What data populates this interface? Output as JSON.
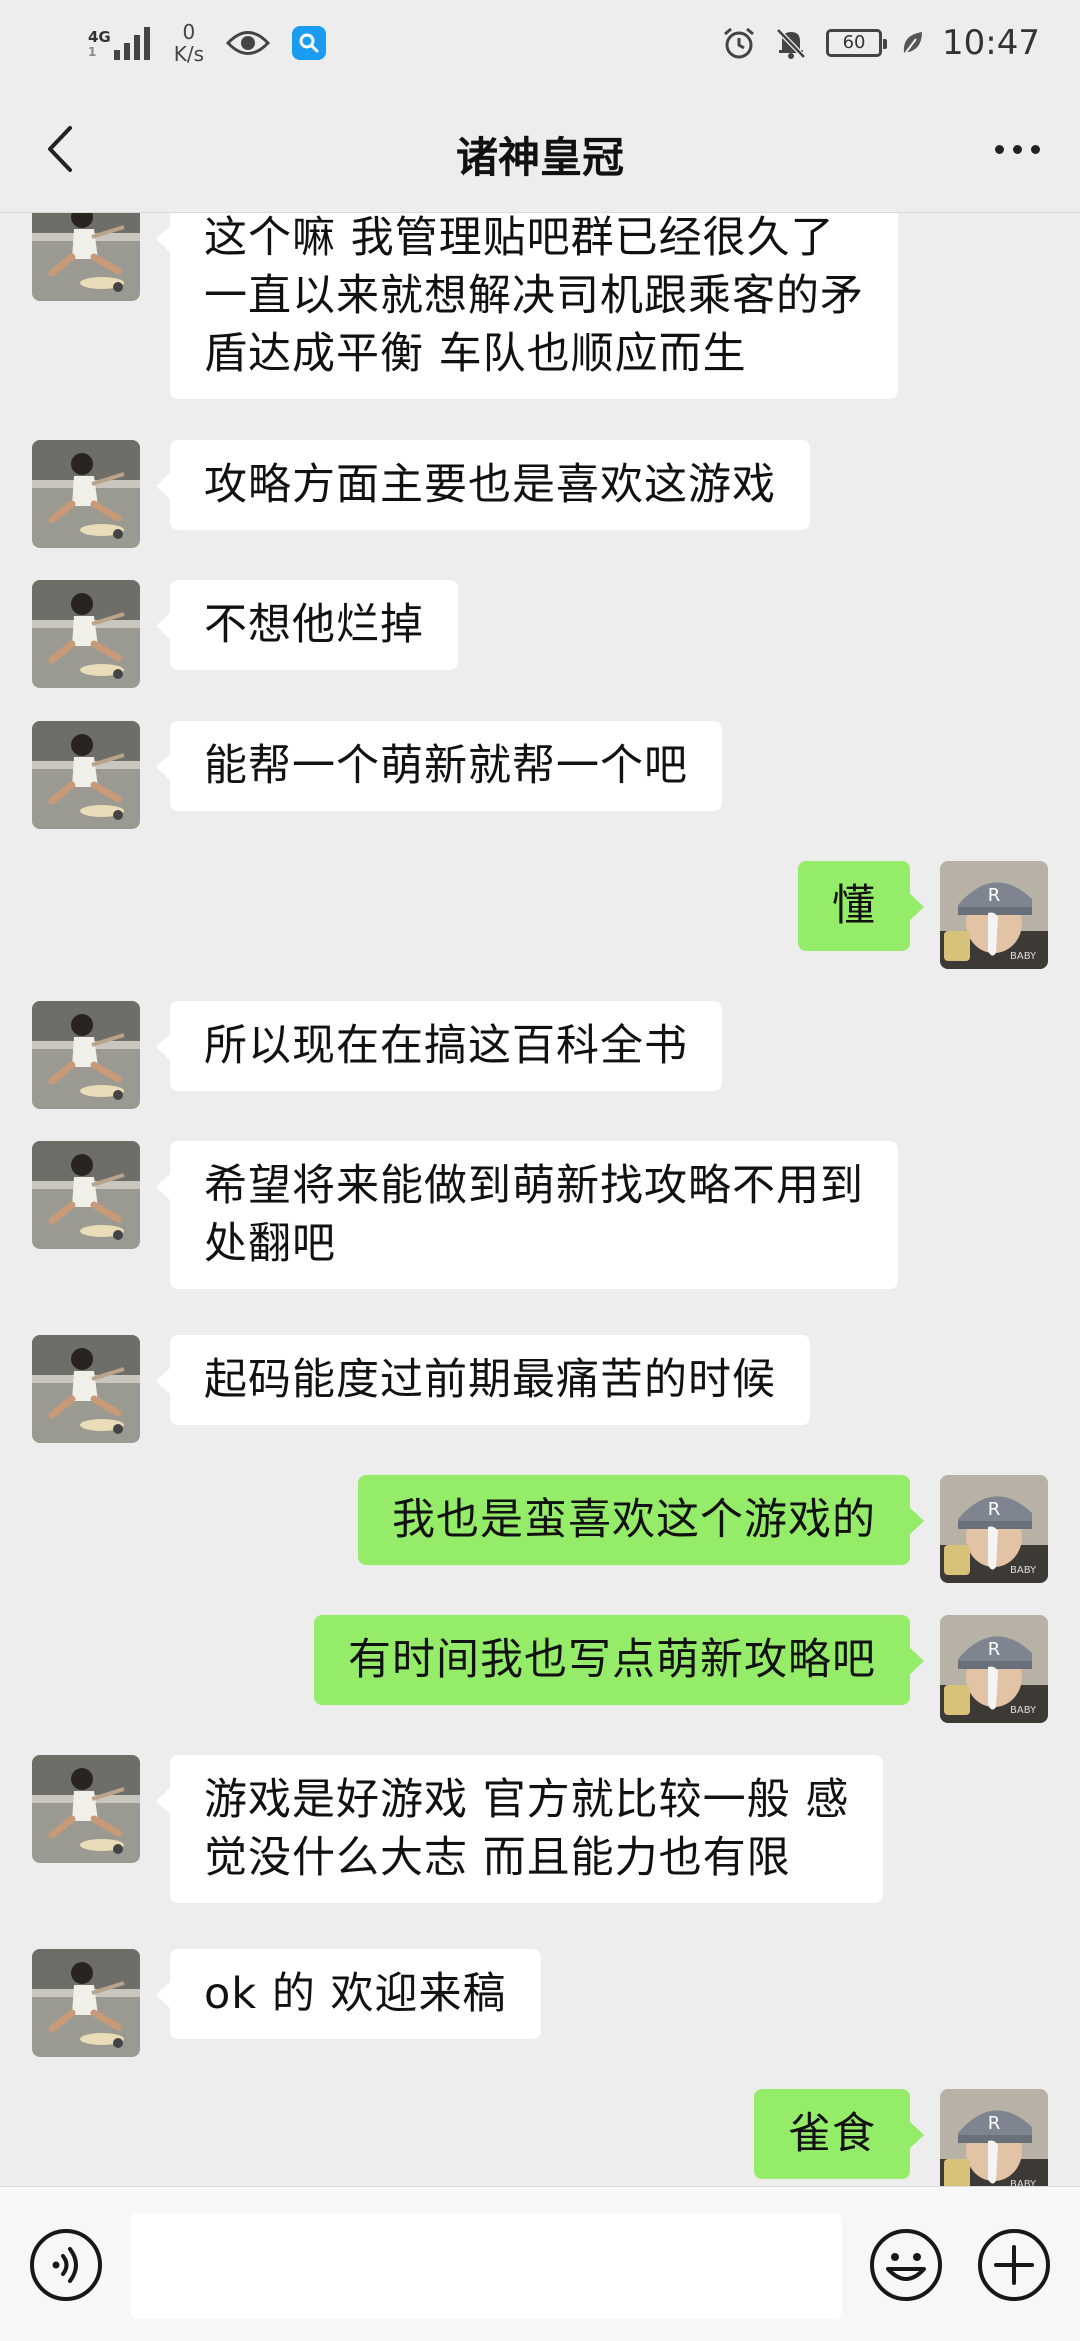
{
  "status_bar": {
    "network": "4G",
    "network_sub": "1",
    "speed_value": "0",
    "speed_unit": "K/s",
    "battery": "60",
    "time": "10:47"
  },
  "header": {
    "title": "诸神皇冠",
    "back_icon": "chevron-left-icon",
    "more_icon": "more-dots-icon"
  },
  "messages": [
    {
      "side": "left",
      "text": "这个嘛 我管理贴吧群已经很久了\n一直以来就想解决司机跟乘客的矛\n盾达成平衡 车队也顺应而生"
    },
    {
      "side": "left",
      "text": "攻略方面主要也是喜欢这游戏"
    },
    {
      "side": "left",
      "text": "不想他烂掉"
    },
    {
      "side": "left",
      "text": "能帮一个萌新就帮一个吧"
    },
    {
      "side": "right",
      "text": "懂"
    },
    {
      "side": "left",
      "text": "所以现在在搞这百科全书"
    },
    {
      "side": "left",
      "text": "希望将来能做到萌新找攻略不用到\n处翻吧"
    },
    {
      "side": "left",
      "text": "起码能度过前期最痛苦的时候"
    },
    {
      "side": "right",
      "text": "我也是蛮喜欢这个游戏的"
    },
    {
      "side": "right",
      "text": "有时间我也写点萌新攻略吧"
    },
    {
      "side": "left",
      "text": "游戏是好游戏 官方就比较一般 感\n觉没什么大志 而且能力也有限"
    },
    {
      "side": "left",
      "text": "ok 的 欢迎来稿"
    },
    {
      "side": "right",
      "text": "雀食"
    }
  ],
  "input_bar": {
    "voice_icon": "voice-icon",
    "text_value": "",
    "emoji_icon": "emoji-icon",
    "plus_icon": "plus-icon"
  },
  "colors": {
    "background": "#ededed",
    "bubble_sent": "#95ec69",
    "bubble_received": "#ffffff"
  }
}
